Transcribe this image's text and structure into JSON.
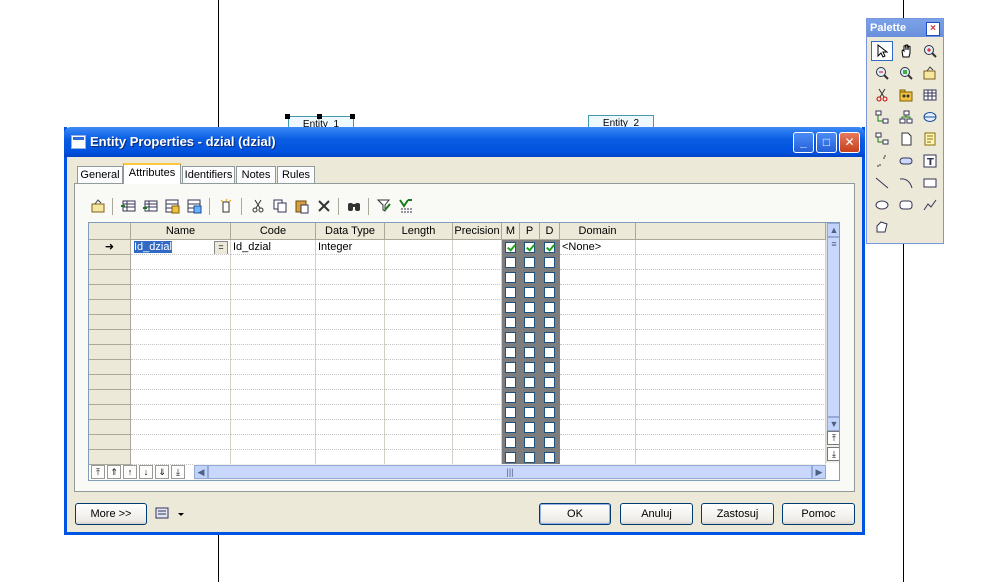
{
  "window": {
    "title": "Entity Properties - dzial (dzial)"
  },
  "canvas": {
    "entity_left_label": "Entity_1",
    "entity_right_label": "Entity_2"
  },
  "palette": {
    "title": "Palette",
    "tools": [
      "pointer-icon",
      "hand-icon",
      "zoom-in-icon",
      "zoom-out-icon",
      "zoom-fit-icon",
      "properties-icon",
      "cut-icon",
      "package-icon",
      "table-icon",
      "inheritance-icon",
      "hierarchy-icon",
      "entity-icon",
      "relationship-icon",
      "file-icon",
      "note-icon",
      "link-icon",
      "domain-icon",
      "text-icon",
      "line-icon",
      "arc-icon",
      "rectangle-icon",
      "ellipse-icon",
      "rounded-rect-icon",
      "polyline-icon",
      "polygon-icon"
    ]
  },
  "tabs": [
    {
      "label": "General"
    },
    {
      "label": "Attributes"
    },
    {
      "label": "Identifiers"
    },
    {
      "label": "Notes"
    },
    {
      "label": "Rules"
    }
  ],
  "active_tab": "Attributes",
  "toolbar": {
    "icons": [
      "properties-icon",
      "add-row-icon",
      "insert-row-icon",
      "add-attributes-icon",
      "reuse-attributes-icon",
      "new-icon",
      "cut-icon",
      "copy-icon",
      "paste-icon",
      "delete-icon",
      "find-icon",
      "customize-columns-icon",
      "filter-icon"
    ]
  },
  "grid": {
    "columns": [
      {
        "label": "Name"
      },
      {
        "label": "Code"
      },
      {
        "label": "Data Type"
      },
      {
        "label": "Length"
      },
      {
        "label": "Precision"
      },
      {
        "label": "M"
      },
      {
        "label": "P"
      },
      {
        "label": "D"
      },
      {
        "label": "Domain"
      }
    ],
    "rows": [
      {
        "name": "Id_dzial",
        "code": "Id_dzial",
        "data_type": "Integer",
        "length": "",
        "precision": "",
        "m": true,
        "p": true,
        "d": true,
        "domain": "<None>"
      }
    ],
    "current_row_marker": "➜",
    "ellipsis_button": "=",
    "empty_rows": 14
  },
  "buttons": {
    "more": "More >>",
    "ok": "OK",
    "cancel": "Anuluj",
    "apply": "Zastosuj",
    "help": "Pomoc"
  },
  "colors": {
    "title_bar": "#0054e3",
    "dialog_bg": "#ece9d8",
    "check": "#21a121"
  }
}
